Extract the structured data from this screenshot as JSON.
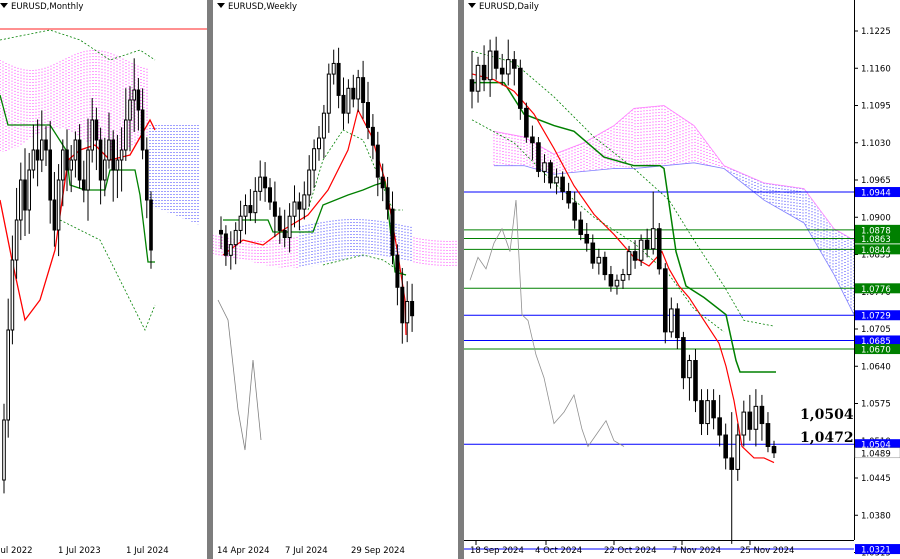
{
  "chart_data": [
    {
      "type": "candlestick",
      "title": "EURUSD,Monthly",
      "x_tick_labels": [
        "Jul 2022",
        "1 Jul 2023",
        "1 Jul 2024"
      ],
      "indicators": [
        "Ichimoku Kinko Hyo"
      ],
      "colors": {
        "tenkan": "#ff0000",
        "kijun": "#008000",
        "cloud_bull": "#ff40ff",
        "cloud_bear": "#4040ff",
        "chikou": "#808080",
        "level": "#ff0000"
      }
    },
    {
      "type": "candlestick",
      "title": "EURUSD,Weekly",
      "x_tick_labels": [
        "14 Apr 2024",
        "7 Jul 2024",
        "29 Sep 2024"
      ],
      "indicators": [
        "Ichimoku Kinko Hyo"
      ],
      "colors": {
        "tenkan": "#ff0000",
        "kijun": "#008000",
        "cloud_bull": "#ff40ff",
        "cloud_bear": "#4040ff",
        "chikou": "#808080"
      }
    },
    {
      "type": "candlestick",
      "title": "EURUSD,Daily",
      "x_tick_labels": [
        "18 Sep 2024",
        "4 Oct 2024",
        "22 Oct 2024",
        "7 Nov 2024",
        "25 Nov 2024"
      ],
      "y_tick_labels": [
        "1.1225",
        "1.1160",
        "1.1095",
        "1.1030",
        "1.0965",
        "1.0900",
        "1.0835",
        "1.0770",
        "1.0705",
        "1.0640",
        "1.0575",
        "1.0510",
        "1.0445",
        "1.0380",
        "1.0315"
      ],
      "ylim": [
        1.0305,
        1.1265
      ],
      "horizontal_levels": [
        {
          "value": 1.0944,
          "label": "1.0944",
          "color": "#0000ff"
        },
        {
          "value": 1.0878,
          "label": "1.0878",
          "color": "#008000"
        },
        {
          "value": 1.0863,
          "label": "1.0863",
          "color": "#008000"
        },
        {
          "value": 1.0844,
          "label": "1.0844",
          "color": "#008000"
        },
        {
          "value": 1.0776,
          "label": "1.0776",
          "color": "#008000"
        },
        {
          "value": 1.0729,
          "label": "1.0729",
          "color": "#0000ff"
        },
        {
          "value": 1.0685,
          "label": "1.0685",
          "color": "#0000ff"
        },
        {
          "value": 1.067,
          "label": "1.0670",
          "color": "#008000"
        },
        {
          "value": 1.0504,
          "label": "1.0504",
          "color": "#0000ff"
        },
        {
          "value": 1.0321,
          "label": "1.0321",
          "color": "#0000ff"
        }
      ],
      "current_price": {
        "value": 1.0489,
        "label": "1.0489"
      },
      "annotations": [
        {
          "text": "1,0504",
          "value": 1.0504
        },
        {
          "text": "1,0472",
          "value": 1.0472
        }
      ],
      "ohlc_approx": [
        [
          1.114,
          1.119,
          1.109,
          1.112
        ],
        [
          1.112,
          1.118,
          1.11,
          1.1165
        ],
        [
          1.1165,
          1.12,
          1.112,
          1.114
        ],
        [
          1.114,
          1.121,
          1.111,
          1.119
        ],
        [
          1.119,
          1.1215,
          1.114,
          1.116
        ],
        [
          1.116,
          1.1185,
          1.113,
          1.115
        ],
        [
          1.115,
          1.121,
          1.113,
          1.1175
        ],
        [
          1.1175,
          1.119,
          1.113,
          1.116
        ],
        [
          1.116,
          1.1175,
          1.107,
          1.109
        ],
        [
          1.109,
          1.11,
          1.103,
          1.104
        ],
        [
          1.104,
          1.106,
          1.1,
          1.103
        ],
        [
          1.103,
          1.104,
          1.097,
          1.098
        ],
        [
          1.098,
          1.101,
          1.096,
          1.0995
        ],
        [
          1.0995,
          1.1,
          1.095,
          1.096
        ],
        [
          1.096,
          1.0985,
          1.094,
          1.097
        ],
        [
          1.097,
          1.098,
          1.093,
          1.0945
        ],
        [
          1.0945,
          1.096,
          1.0915,
          1.0925
        ],
        [
          1.0925,
          1.0945,
          1.088,
          1.0895
        ],
        [
          1.0895,
          1.091,
          1.086,
          1.087
        ],
        [
          1.087,
          1.089,
          1.084,
          1.0855
        ],
        [
          1.0855,
          1.087,
          1.081,
          1.082
        ],
        [
          1.082,
          1.0845,
          1.08,
          1.083
        ],
        [
          1.083,
          1.084,
          1.079,
          1.08
        ],
        [
          1.08,
          1.0815,
          1.077,
          1.078
        ],
        [
          1.078,
          1.08,
          1.0765,
          1.079
        ],
        [
          1.079,
          1.081,
          1.0775,
          1.08
        ],
        [
          1.08,
          1.085,
          1.079,
          1.084
        ],
        [
          1.084,
          1.086,
          1.081,
          1.0825
        ],
        [
          1.0825,
          1.087,
          1.0815,
          1.086
        ],
        [
          1.086,
          1.088,
          1.083,
          1.0845
        ],
        [
          1.0845,
          1.0945,
          1.0835,
          1.088
        ],
        [
          1.088,
          1.089,
          1.08,
          1.081
        ],
        [
          1.081,
          1.082,
          1.068,
          1.07
        ],
        [
          1.07,
          1.076,
          1.069,
          1.074
        ],
        [
          1.074,
          1.075,
          1.067,
          1.069
        ],
        [
          1.069,
          1.07,
          1.06,
          1.062
        ],
        [
          1.062,
          1.066,
          1.058,
          1.065
        ],
        [
          1.065,
          1.067,
          1.056,
          1.058
        ],
        [
          1.058,
          1.06,
          1.052,
          1.054
        ],
        [
          1.054,
          1.06,
          1.052,
          1.058
        ],
        [
          1.058,
          1.06,
          1.053,
          1.055
        ],
        [
          1.055,
          1.059,
          1.05,
          1.052
        ],
        [
          1.052,
          1.054,
          1.046,
          1.048
        ],
        [
          1.048,
          1.056,
          1.033,
          1.046
        ],
        [
          1.046,
          1.054,
          1.044,
          1.052
        ],
        [
          1.052,
          1.058,
          1.05,
          1.056
        ],
        [
          1.056,
          1.059,
          1.051,
          1.053
        ],
        [
          1.053,
          1.06,
          1.05,
          1.057
        ],
        [
          1.057,
          1.059,
          1.051,
          1.054
        ],
        [
          1.054,
          1.056,
          1.049,
          1.05
        ],
        [
          1.05,
          1.051,
          1.048,
          1.0489
        ]
      ]
    }
  ]
}
